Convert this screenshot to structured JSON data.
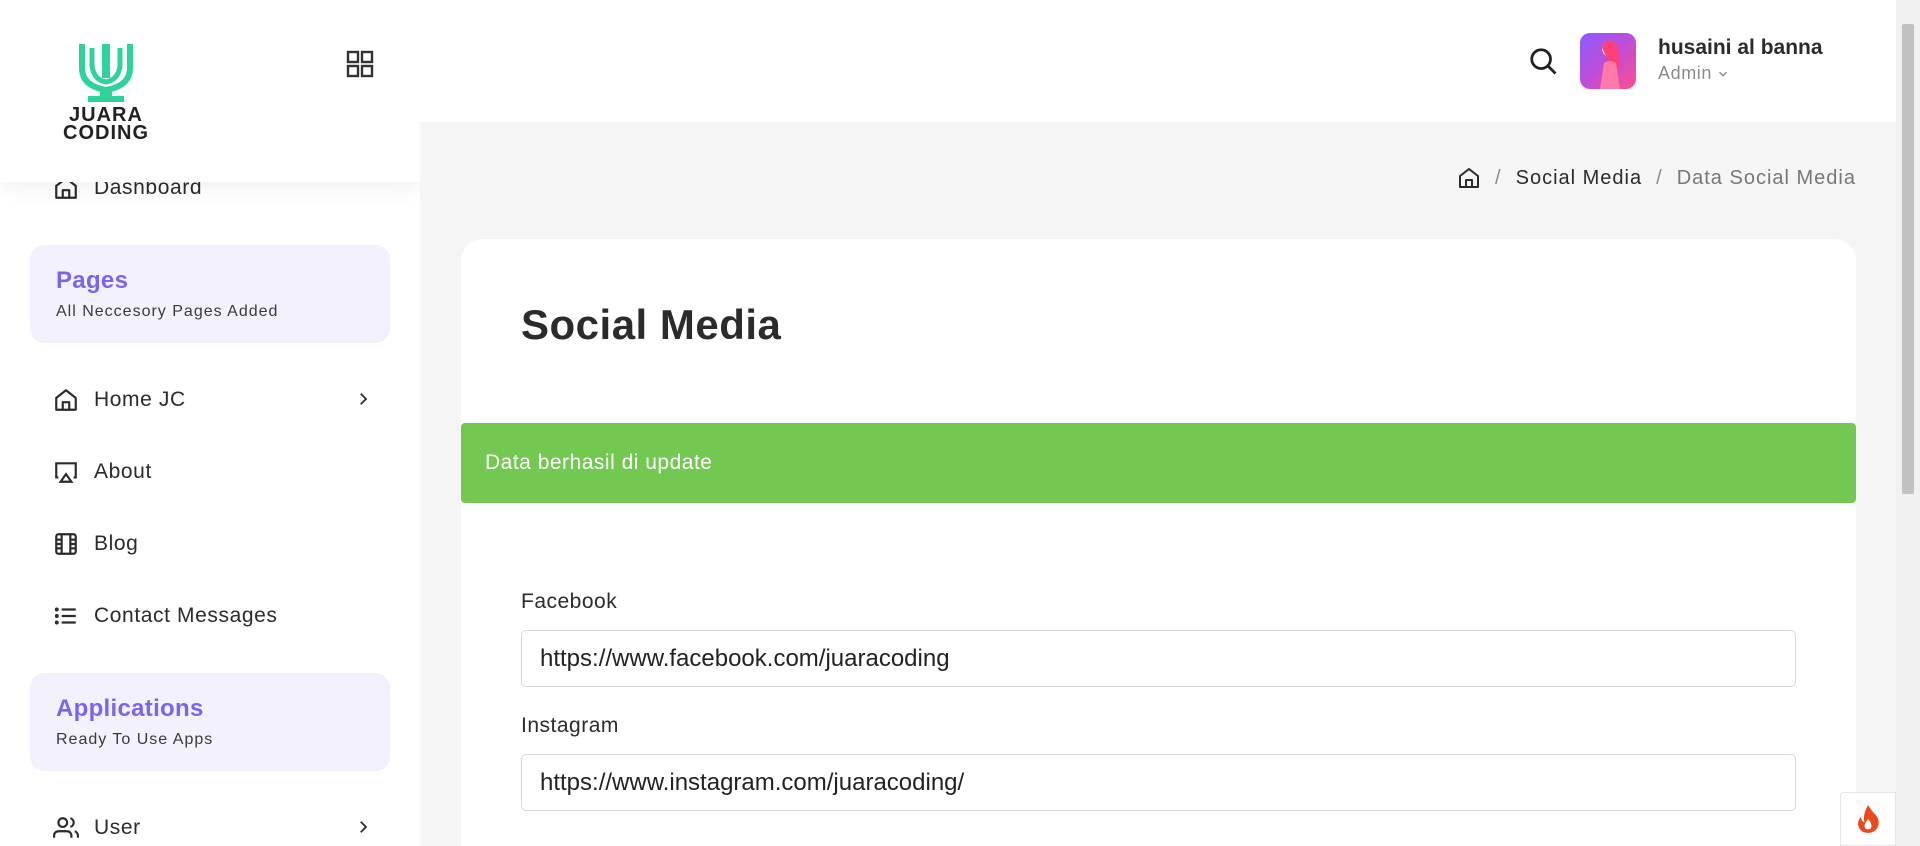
{
  "brand": {
    "logo_text_line1": "JUARA",
    "logo_text_line2": "CODING"
  },
  "sidebar": {
    "dashboard_label": "Dashboard",
    "pages_section": {
      "title": "Pages",
      "subtitle": "All Neccesory Pages Added"
    },
    "items": [
      {
        "label": "Home JC",
        "icon": "home-icon",
        "has_submenu": true
      },
      {
        "label": "About",
        "icon": "airplay-icon",
        "has_submenu": false
      },
      {
        "label": "Blog",
        "icon": "film-icon",
        "has_submenu": false
      },
      {
        "label": "Contact Messages",
        "icon": "list-icon",
        "has_submenu": false
      }
    ],
    "apps_section": {
      "title": "Applications",
      "subtitle": "Ready To Use Apps"
    },
    "user_item": {
      "label": "User",
      "icon": "users-icon",
      "has_submenu": true
    }
  },
  "header": {
    "user_name": "husaini al banna",
    "user_role": "Admin"
  },
  "breadcrumb": {
    "items": [
      "Social Media",
      "Data Social Media"
    ]
  },
  "main": {
    "title": "Social Media",
    "alert": "Data berhasil di update",
    "fields": [
      {
        "label": "Facebook",
        "value": "https://www.facebook.com/juaracoding"
      },
      {
        "label": "Instagram",
        "value": "https://www.instagram.com/juaracoding/"
      }
    ]
  },
  "colors": {
    "accent": "#7966e8",
    "success": "#72c851",
    "logo_green": "#2ed39a"
  }
}
